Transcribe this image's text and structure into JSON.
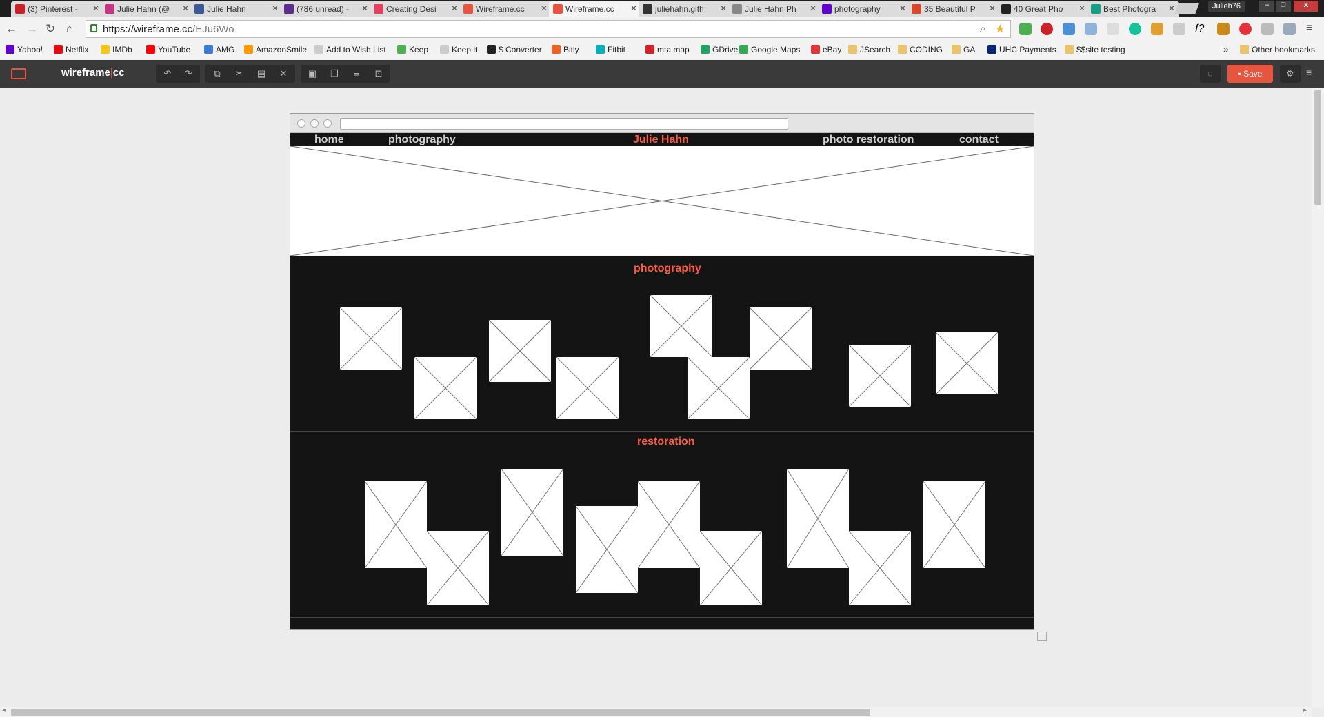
{
  "browser": {
    "tabs": [
      {
        "label": "(3) Pinterest - ",
        "color": "#cb2027"
      },
      {
        "label": "Julie Hahn (@",
        "color": "#c13584"
      },
      {
        "label": "Julie Hahn",
        "color": "#3b5998"
      },
      {
        "label": "(786 unread) -",
        "color": "#5b2d8e"
      },
      {
        "label": "Creating Desi",
        "color": "#e4405f"
      },
      {
        "label": "Wireframe.cc",
        "color": "#e8553f"
      },
      {
        "label": "Wireframe.cc",
        "color": "#e8553f",
        "active": true
      },
      {
        "label": "juliehahn.gith",
        "color": "#333333"
      },
      {
        "label": "Julie Hahn Ph",
        "color": "#888888"
      },
      {
        "label": "photography",
        "color": "#6001d2"
      },
      {
        "label": "35 Beautiful P",
        "color": "#d9472b"
      },
      {
        "label": "40 Great Pho",
        "color": "#222222"
      },
      {
        "label": "Best Photogra",
        "color": "#14a085"
      }
    ],
    "user": "Julieh76",
    "url_host": "https://wireframe.cc",
    "url_path": "/EJu6Wo"
  },
  "bookmarks": [
    {
      "label": "Yahoo!",
      "color": "#6001d2"
    },
    {
      "label": "Netflix",
      "color": "#e50914"
    },
    {
      "label": "IMDb",
      "color": "#f5c518"
    },
    {
      "label": "YouTube",
      "color": "#ff0000"
    },
    {
      "label": "AMG",
      "color": "#3a7bd5"
    },
    {
      "label": "AmazonSmile",
      "color": "#ff9900"
    },
    {
      "label": "Add to Wish List",
      "color": "#cccccc"
    },
    {
      "label": "Keep",
      "color": "#4caf50"
    },
    {
      "label": "Keep it",
      "color": "#cccccc"
    },
    {
      "label": "$ Converter",
      "color": "#222222"
    },
    {
      "label": "Bitly",
      "color": "#ee6123"
    },
    {
      "label": "Fitbit",
      "color": "#00b0b9"
    },
    {
      "label": "mta map",
      "color": "#d62027"
    },
    {
      "label": "GDrive",
      "color": "#1fa463"
    },
    {
      "label": "Google Maps",
      "color": "#34a853"
    },
    {
      "label": "eBay",
      "color": "#e53238"
    },
    {
      "label": "JSearch",
      "folder": true
    },
    {
      "label": "CODING",
      "folder": true
    },
    {
      "label": "GA",
      "folder": true
    },
    {
      "label": "UHC Payments",
      "color": "#002677"
    },
    {
      "label": "$$site testing",
      "folder": true
    }
  ],
  "other_bookmarks": "Other bookmarks",
  "app": {
    "brand_left": "wireframe",
    "brand_sep": "|",
    "brand_right": "cc",
    "save_label": "Save"
  },
  "mockup": {
    "nav": {
      "home": "home",
      "photography": "photography",
      "brand": "Julie Hahn",
      "restoration": "photo restoration",
      "contact": "contact"
    },
    "sections": {
      "photography_title": "photography",
      "restoration_title": "restoration"
    }
  },
  "colors": {
    "accent": "#ff5b3e",
    "app_bar": "#3a3a3a",
    "mockup_bg": "#141414"
  }
}
